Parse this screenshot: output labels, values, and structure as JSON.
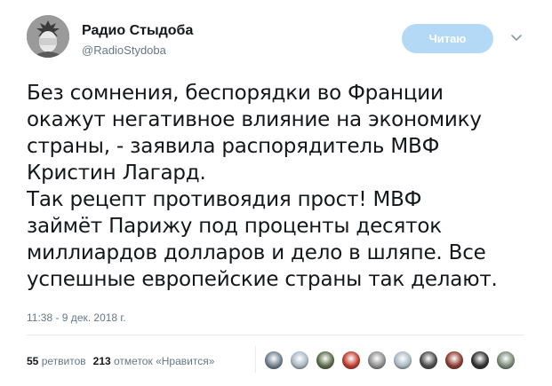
{
  "author": {
    "name": "Радио Стыдоба",
    "handle": "@RadioStydoba"
  },
  "actions": {
    "follow_label": "Читаю"
  },
  "tweet": {
    "lines": [
      "Без сомнения, беспорядки во Франции",
      "окажут негативное влияние на экономику",
      "страны, - заявила распорядитель МВФ",
      "Кристин Лагард.",
      "Так рецепт противоядия прост! МВФ",
      "займёт Парижу под проценты десяток",
      "миллиардов долларов и дело в шляпе. Все",
      "успешные европейские страны так делают."
    ],
    "timestamp": "11:38 - 9 дек. 2018 г."
  },
  "stats": {
    "retweets_count": "55",
    "retweets_label": "ретвитов",
    "likes_count": "213",
    "likes_label": "отметок «Нравится»"
  },
  "likers": [
    {
      "icon": "liker-avatar-1",
      "color": "#6f7f8c"
    },
    {
      "icon": "liker-avatar-2",
      "color": "#aab8c2"
    },
    {
      "icon": "liker-avatar-3",
      "color": "#5c6b4a"
    },
    {
      "icon": "liker-avatar-4",
      "color": "#c0392b"
    },
    {
      "icon": "liker-avatar-5",
      "color": "#8e8e8e"
    },
    {
      "icon": "liker-avatar-6",
      "color": "#aab8c2"
    },
    {
      "icon": "liker-avatar-7",
      "color": "#4a4a4a"
    },
    {
      "icon": "liker-avatar-8",
      "color": "#8b3a2e"
    },
    {
      "icon": "liker-avatar-9",
      "color": "#2f2f2f"
    },
    {
      "icon": "liker-avatar-10",
      "color": "#7a8a7a"
    }
  ]
}
